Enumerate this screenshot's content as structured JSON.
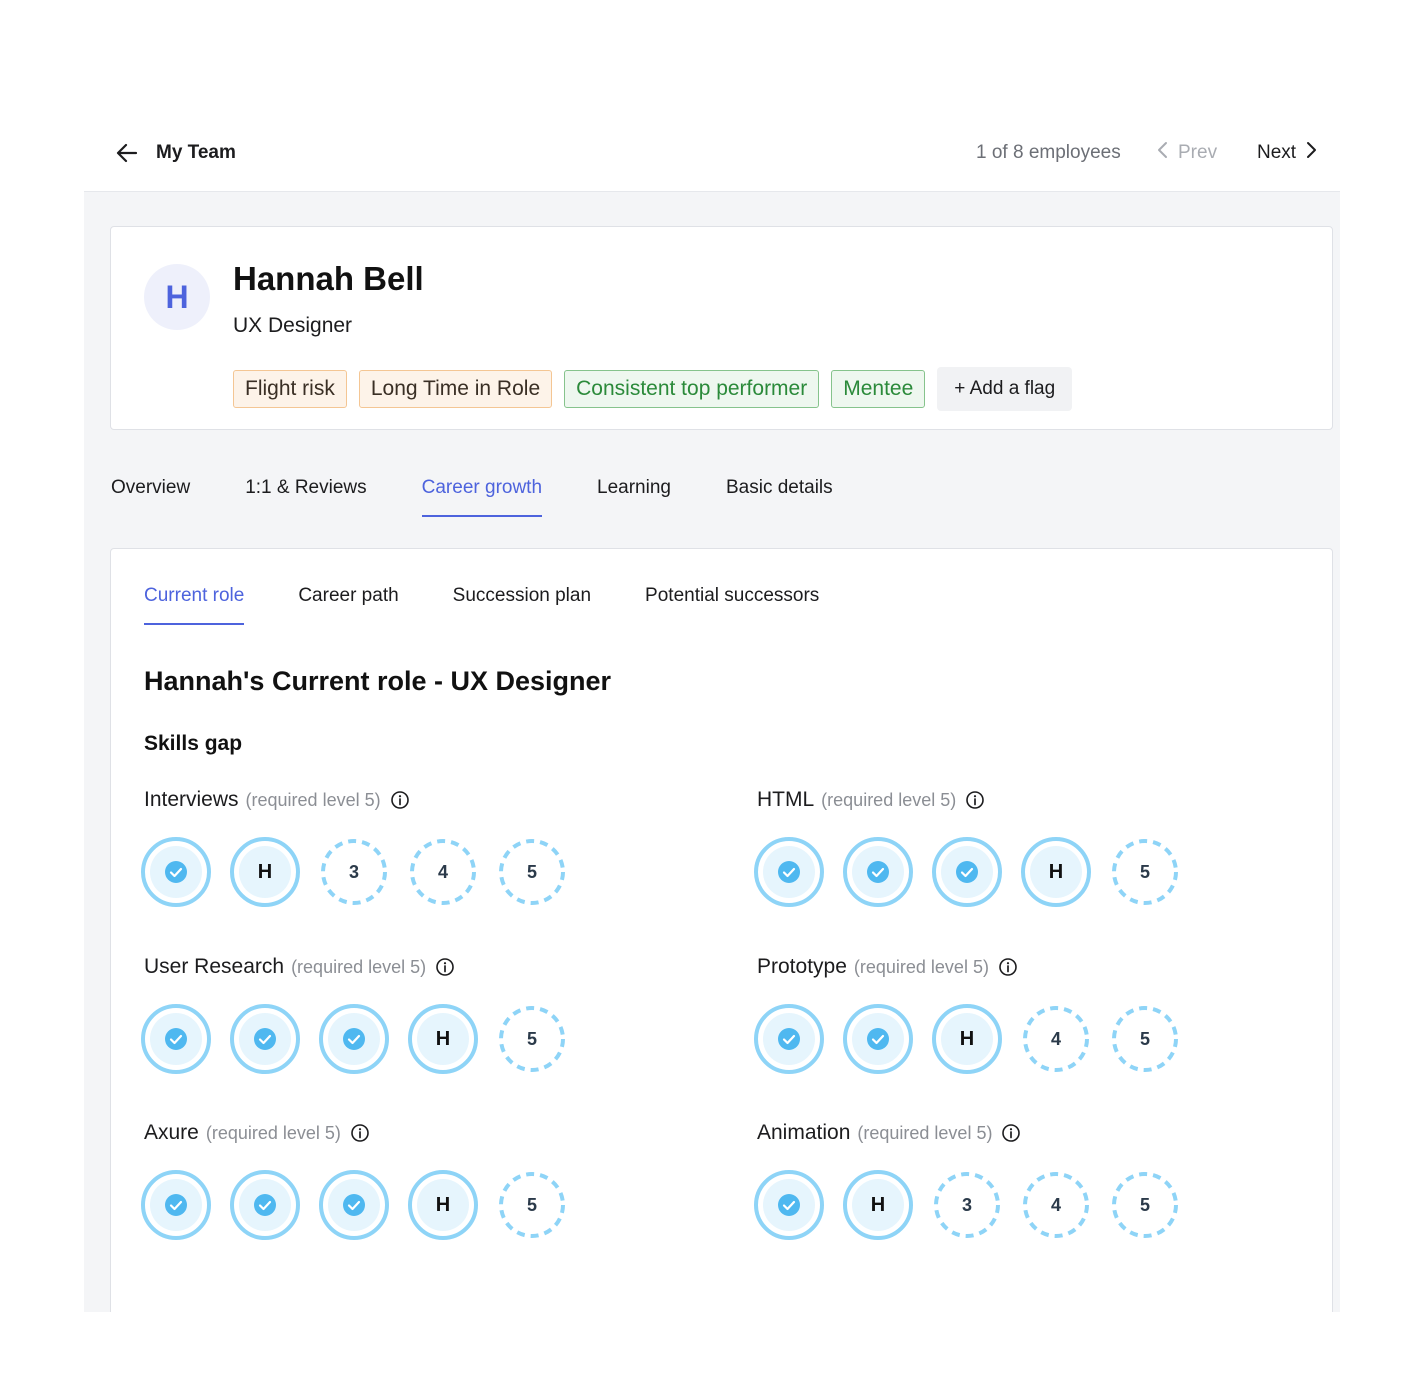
{
  "header": {
    "title": "My Team",
    "count": "1 of 8 employees",
    "prev_label": "Prev",
    "next_label": "Next"
  },
  "profile": {
    "initial": "H",
    "name": "Hannah Bell",
    "role": "UX Designer",
    "flags": [
      {
        "label": "Flight risk",
        "kind": "warn"
      },
      {
        "label": "Long Time in Role",
        "kind": "warn"
      },
      {
        "label": "Consistent top performer",
        "kind": "good"
      },
      {
        "label": "Mentee",
        "kind": "good"
      }
    ],
    "add_flag_label": "+ Add a flag"
  },
  "tabs": [
    "Overview",
    "1:1 & Reviews",
    "Career growth",
    "Learning",
    "Basic details"
  ],
  "active_tab": "Career growth",
  "subtabs": [
    "Current role",
    "Career path",
    "Succession plan",
    "Potential successors"
  ],
  "active_subtab": "Current role",
  "section_title": "Hannah's Current role - UX Designer",
  "skills_gap_title": "Skills gap",
  "skills": [
    {
      "name": "Interviews",
      "required": "(required level 5)",
      "levels": [
        "done",
        "H",
        "3",
        "4",
        "5"
      ]
    },
    {
      "name": "HTML",
      "required": "(required level 5)",
      "levels": [
        "done",
        "done",
        "done",
        "H",
        "5"
      ]
    },
    {
      "name": "User Research",
      "required": "(required level 5)",
      "levels": [
        "done",
        "done",
        "done",
        "H",
        "5"
      ]
    },
    {
      "name": "Prototype",
      "required": "(required level 5)",
      "levels": [
        "done",
        "done",
        "H",
        "4",
        "5"
      ]
    },
    {
      "name": "Axure",
      "required": "(required level 5)",
      "levels": [
        "done",
        "done",
        "done",
        "H",
        "5"
      ]
    },
    {
      "name": "Animation",
      "required": "(required level 5)",
      "levels": [
        "done",
        "H",
        "3",
        "4",
        "5"
      ]
    }
  ],
  "colors": {
    "accent": "#4d63dd",
    "level_ring": "#8ed4f7",
    "level_fill": "#e6f5fd",
    "check_fill": "#4fb8f0",
    "warn_bg": "#fdf3e9",
    "warn_border": "#f4c694",
    "good_bg": "#eef7ef",
    "good_border": "#86c38c",
    "good_text": "#2b8a3a"
  }
}
